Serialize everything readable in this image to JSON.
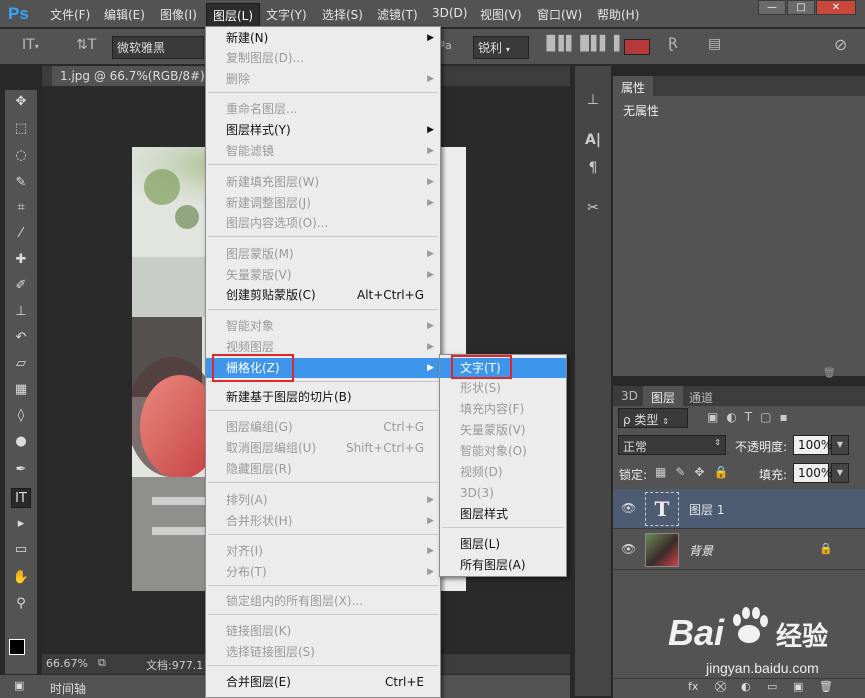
{
  "app": {
    "logo": "Ps"
  },
  "menubar": {
    "items": [
      "文件(F)",
      "编辑(E)",
      "图像(I)",
      "图层(L)",
      "文字(Y)",
      "选择(S)",
      "滤镜(T)",
      "3D(D)",
      "视图(V)",
      "窗口(W)",
      "帮助(H)"
    ],
    "window_buttons": [
      "—",
      "□",
      "✕"
    ]
  },
  "options": {
    "font_family": "微软雅黑",
    "aa_label": "ªa",
    "antialias": "锐利",
    "text_color": "#b5383a"
  },
  "document": {
    "tab_title": "1.jpg @ 66.7%(RGB/8#)",
    "tab_close": "×",
    "zoom": "66.67%",
    "doc_info": "文档:977.1"
  },
  "timeline": {
    "label": "时间轴"
  },
  "layer_menu": {
    "items": [
      {
        "label": "新建(N)",
        "shortcut": "",
        "submenu": true,
        "disabled": false
      },
      {
        "label": "复制图层(D)...",
        "shortcut": "",
        "submenu": false,
        "disabled": true
      },
      {
        "label": "删除",
        "shortcut": "",
        "submenu": true,
        "disabled": true
      },
      {
        "label": "重命名图层...",
        "shortcut": "",
        "submenu": false,
        "disabled": true
      },
      {
        "label": "图层样式(Y)",
        "shortcut": "",
        "submenu": true,
        "disabled": false
      },
      {
        "label": "智能滤镜",
        "shortcut": "",
        "submenu": true,
        "disabled": true
      },
      {
        "label": "新建填充图层(W)",
        "shortcut": "",
        "submenu": true,
        "disabled": true
      },
      {
        "label": "新建调整图层(J)",
        "shortcut": "",
        "submenu": true,
        "disabled": true
      },
      {
        "label": "图层内容选项(O)...",
        "shortcut": "",
        "submenu": false,
        "disabled": true
      },
      {
        "label": "图层蒙版(M)",
        "shortcut": "",
        "submenu": true,
        "disabled": true
      },
      {
        "label": "矢量蒙版(V)",
        "shortcut": "",
        "submenu": true,
        "disabled": true
      },
      {
        "label": "创建剪贴蒙版(C)",
        "shortcut": "Alt+Ctrl+G",
        "submenu": false,
        "disabled": false
      },
      {
        "label": "智能对象",
        "shortcut": "",
        "submenu": true,
        "disabled": true
      },
      {
        "label": "视频图层",
        "shortcut": "",
        "submenu": true,
        "disabled": true
      },
      {
        "label": "栅格化(Z)",
        "shortcut": "",
        "submenu": true,
        "disabled": false,
        "highlighted": true
      },
      {
        "label": "新建基于图层的切片(B)",
        "shortcut": "",
        "submenu": false,
        "disabled": false
      },
      {
        "label": "图层编组(G)",
        "shortcut": "Ctrl+G",
        "submenu": false,
        "disabled": true
      },
      {
        "label": "取消图层编组(U)",
        "shortcut": "Shift+Ctrl+G",
        "submenu": false,
        "disabled": true
      },
      {
        "label": "隐藏图层(R)",
        "shortcut": "",
        "submenu": false,
        "disabled": true
      },
      {
        "label": "排列(A)",
        "shortcut": "",
        "submenu": true,
        "disabled": true
      },
      {
        "label": "合并形状(H)",
        "shortcut": "",
        "submenu": true,
        "disabled": true
      },
      {
        "label": "对齐(I)",
        "shortcut": "",
        "submenu": true,
        "disabled": true
      },
      {
        "label": "分布(T)",
        "shortcut": "",
        "submenu": true,
        "disabled": true
      },
      {
        "label": "锁定组内的所有图层(X)...",
        "shortcut": "",
        "submenu": false,
        "disabled": true
      },
      {
        "label": "链接图层(K)",
        "shortcut": "",
        "submenu": false,
        "disabled": true
      },
      {
        "label": "选择链接图层(S)",
        "shortcut": "",
        "submenu": false,
        "disabled": true
      },
      {
        "label": "合并图层(E)",
        "shortcut": "Ctrl+E",
        "submenu": false,
        "disabled": false
      }
    ]
  },
  "rasterize_submenu": {
    "items": [
      {
        "label": "文字(T)",
        "disabled": false,
        "highlighted": true
      },
      {
        "label": "形状(S)",
        "disabled": true
      },
      {
        "label": "填充内容(F)",
        "disabled": true
      },
      {
        "label": "矢量蒙版(V)",
        "disabled": true
      },
      {
        "label": "智能对象(O)",
        "disabled": true
      },
      {
        "label": "视频(D)",
        "disabled": true
      },
      {
        "label": "3D(3)",
        "disabled": true
      },
      {
        "label": "图层样式",
        "disabled": false
      },
      {
        "label": "图层(L)",
        "disabled": false
      },
      {
        "label": "所有图层(A)",
        "disabled": false
      }
    ]
  },
  "properties": {
    "tab": "属性",
    "empty": "无属性"
  },
  "layers_panel": {
    "tabs": [
      "3D",
      "图层",
      "通道"
    ],
    "filter_kind": "ρ 类型",
    "blend_mode": "正常",
    "opacity_label": "不透明度:",
    "opacity": "100%",
    "lock_label": "锁定:",
    "fill_label": "填充:",
    "fill": "100%",
    "layers": [
      {
        "name": "图层 1",
        "type": "text",
        "thumb_glyph": "T",
        "selected": true
      },
      {
        "name": "背景",
        "type": "image",
        "locked": true,
        "selected": false
      }
    ],
    "bottom_icons": [
      "fx",
      "⛒",
      "◐",
      "▭",
      "▣",
      "🗑"
    ]
  },
  "watermark": {
    "brand": "Bai",
    "brand2": "经验",
    "site": "jingyan.baidu.com"
  },
  "colors": {
    "highlight": "#3e95ec",
    "outline": "#e0262b",
    "selected_layer": "#4e5c73"
  }
}
